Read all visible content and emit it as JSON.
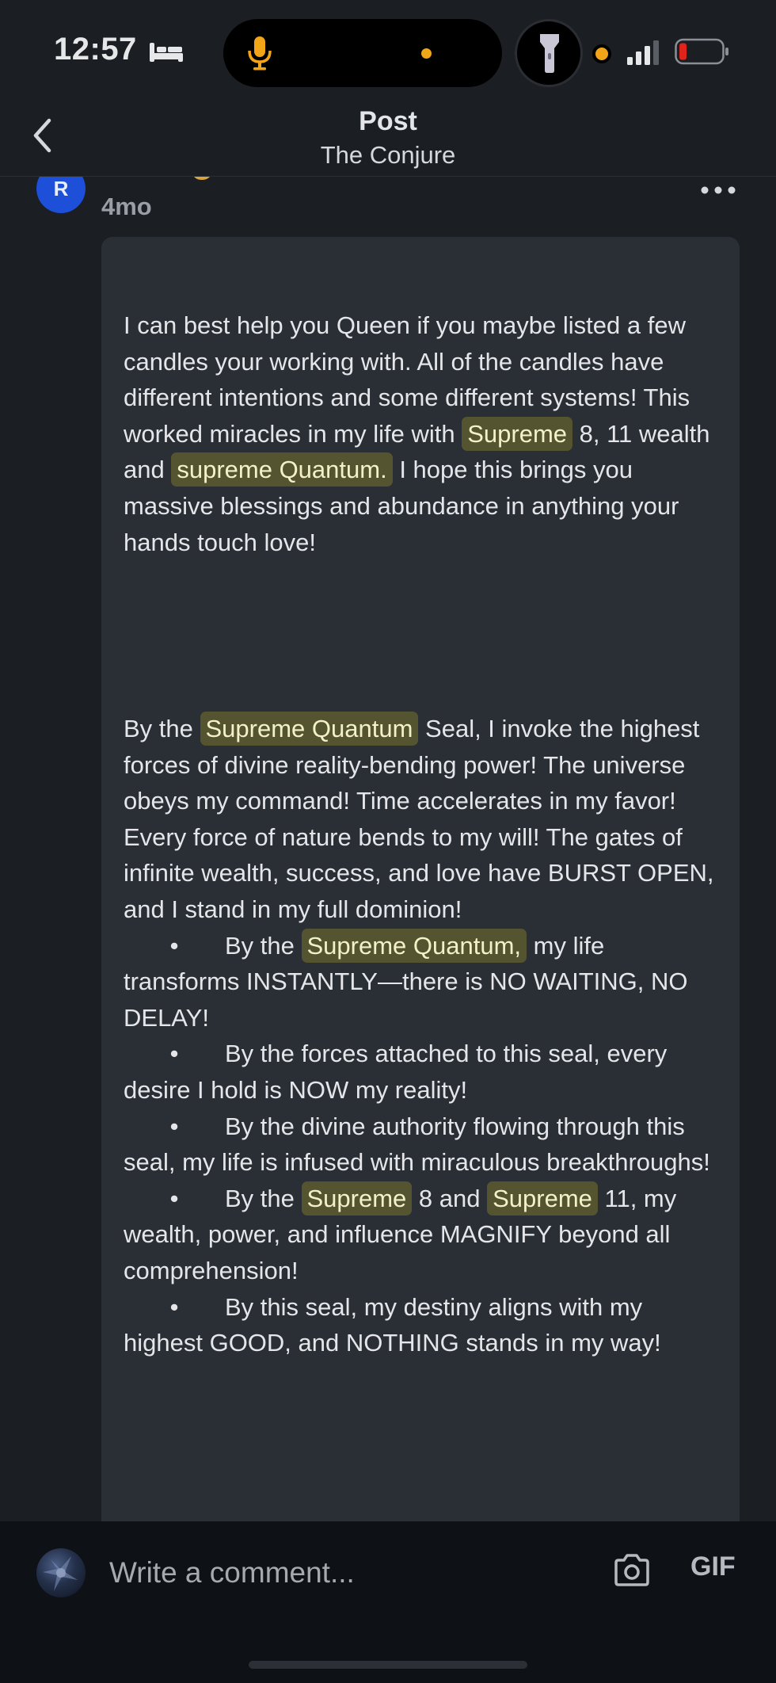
{
  "status_bar": {
    "time": "12:57"
  },
  "header": {
    "title": "Post",
    "subtitle": "The Conjure"
  },
  "comment": {
    "author_initial": "R",
    "time_ago": "4mo",
    "p1": [
      "I can best help you Queen if you maybe listed a few candles your working with. All of the candles have different intentions and some different systems! This worked miracles in my life with ",
      "Supreme",
      " 8, 11 wealth and ",
      "supreme Quantum.",
      " I hope this brings you massive blessings and abundance in anything your hands touch love!"
    ],
    "p2": {
      "intro": [
        "By the ",
        "Supreme Quantum",
        " Seal, I invoke the highest forces of divine reality-bending power! The universe obeys my command! Time accelerates in my favor! Every force of nature bends to my will! The gates of infinite wealth, success, and love have BURST OPEN, and I stand in my full dominion!"
      ],
      "bullet_char": "•",
      "b1": [
        "By the ",
        "Supreme Quantum,",
        " my life transforms INSTANTLY—there is NO WAITING, NO DELAY!"
      ],
      "b2": "By the forces attached to this seal, every desire I hold is NOW my reality!",
      "b3": "By the divine authority flowing through this seal, my life is infused with miraculous breakthroughs!",
      "b4": [
        "By the ",
        "Supreme",
        " 8 and ",
        "Supreme",
        " 11, my wealth, power, and influence MAGNIFY beyond all comprehension!"
      ],
      "b5": "By this seal, my destiny aligns with my highest GOOD, and NOTHING stands in my way!"
    }
  },
  "composer": {
    "placeholder": "Write a comment...",
    "gif_label": "GIF"
  },
  "colors": {
    "highlight_bg": "#555431",
    "highlight_text": "#f3f1c8",
    "bubble_bg": "#2a2e35",
    "avatar_blue": "#1d4fd8"
  },
  "icons": [
    "bed-icon",
    "mic-icon",
    "flashlight-icon",
    "signal-icon",
    "battery-icon",
    "back-chevron-icon",
    "more-options-icon",
    "camera-icon"
  ]
}
